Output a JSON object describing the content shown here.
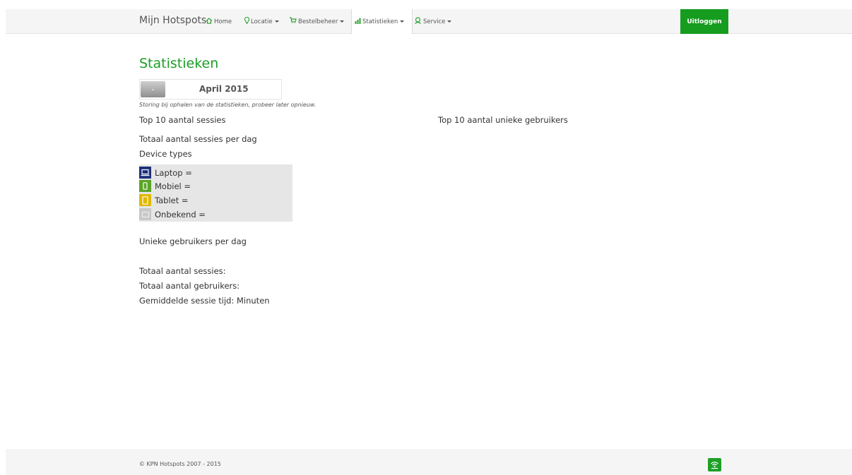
{
  "nav": {
    "brand": "Mijn Hotspots",
    "items": [
      {
        "label": "Home",
        "icon": "home-icon"
      },
      {
        "label": "Locatie",
        "icon": "map-pin-icon"
      },
      {
        "label": "Bestelbeheer",
        "icon": "cart-icon"
      },
      {
        "label": "Statistieken",
        "icon": "bar-chart-icon"
      },
      {
        "label": "Service",
        "icon": "support-icon"
      }
    ],
    "logout_label": "Uitloggen"
  },
  "main": {
    "title": "Statistieken",
    "month_button": "-",
    "month_label": "April 2015",
    "error_text": "Storing bij ophalen van de statistieken, probeer later opnieuw.",
    "top10_sessions": "Top 10 aantal sessies",
    "top10_users": "Top 10 aantal unieke gebruikers",
    "sessions_per_day": "Totaal aantal sessies per dag",
    "device_types": "Device types",
    "devices": [
      {
        "label": "Laptop =",
        "icon": "laptop-icon",
        "color": "#1c2f7a"
      },
      {
        "label": "Mobiel =",
        "icon": "mobile-icon",
        "color": "#5aa528"
      },
      {
        "label": "Tablet =",
        "icon": "tablet-icon",
        "color": "#e0b800"
      },
      {
        "label": "Onbekend =",
        "icon": "unknown-device-icon",
        "color": "#c8c8c8"
      }
    ],
    "unique_users_per_day": "Unieke gebruikers per dag",
    "total_sessions": "Totaal aantal sessies:",
    "total_users": "Totaal aantal gebruikers:",
    "avg_session": "Gemiddelde sessie tijd:  Minuten"
  },
  "footer": {
    "copyright": "© KPN Hotspots 2007 - 2015",
    "logo_icon": "kpn-hotspots-wifi-icon"
  },
  "colors": {
    "accent": "#1a9e24",
    "logout_bg": "#169c1f"
  }
}
